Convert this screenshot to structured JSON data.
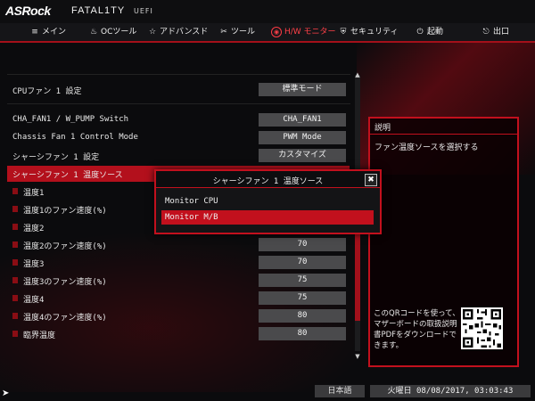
{
  "header": {
    "brand": "ASRock",
    "product": "FATAL1TY",
    "suffix": "UEFI"
  },
  "nav": {
    "tabs": [
      {
        "icon": "≡",
        "label": "メイン"
      },
      {
        "icon": "♨",
        "label": "OCツール"
      },
      {
        "icon": "☆",
        "label": "アドバンスド"
      },
      {
        "icon": "✂",
        "label": "ツール"
      },
      {
        "icon": "◉",
        "label": "H/W モニター"
      },
      {
        "icon": "⛨",
        "label": "セキュリティ"
      },
      {
        "icon": "⏻",
        "label": "起動"
      },
      {
        "icon": "⎋",
        "label": "出口"
      }
    ],
    "active_index": 4
  },
  "settings": {
    "cpu_fan": {
      "label": "CPUファン 1 設定",
      "value": "標準モード"
    },
    "switch": {
      "label": "CHA_FAN1 / W_PUMP Switch",
      "value": "CHA_FAN1"
    },
    "control_mode": {
      "label": "Chassis Fan 1 Control Mode",
      "value": "PWM Mode"
    },
    "chassis_setting": {
      "label": "シャーシファン 1 設定",
      "value": "カスタマイズ"
    },
    "temp_source": {
      "label": "シャーシファン 1 温度ソース"
    },
    "temp1": {
      "label": "温度1"
    },
    "temp1_speed": {
      "label": "温度1のファン速度(%)"
    },
    "temp2": {
      "label": "温度2"
    },
    "temp2_speed": {
      "label": "温度2のファン速度(%)",
      "value": "70"
    },
    "temp3": {
      "label": "温度3",
      "value": "70"
    },
    "temp3_speed": {
      "label": "温度3のファン速度(%)",
      "value": "75"
    },
    "temp4": {
      "label": "温度4",
      "value": "75"
    },
    "temp4_speed": {
      "label": "温度4のファン速度(%)",
      "value": "80"
    },
    "critical": {
      "label": "臨界温度",
      "value": "80"
    }
  },
  "popup": {
    "title": "シャーシファン 1 温度ソース",
    "close": "✖",
    "options": [
      "Monitor CPU",
      "Monitor M/B"
    ],
    "selected_index": 1
  },
  "description": {
    "title": "説明",
    "text": "ファン温度ソースを選択する",
    "qr_text": "このQRコードを使って、マザーボードの取扱説明書PDFをダウンロードできます。"
  },
  "footer": {
    "language": "日本語",
    "datetime": "火曜日 08/08/2017, 03:03:43"
  },
  "colors": {
    "accent": "#c2101d",
    "value_bg": "#4a4a4c",
    "background": "#0b0b0d"
  },
  "icons": [
    "menu-icon",
    "flame-icon",
    "star-icon",
    "tools-icon",
    "monitor-icon",
    "shield-icon",
    "power-icon",
    "exit-icon",
    "close-icon",
    "qr-code"
  ]
}
